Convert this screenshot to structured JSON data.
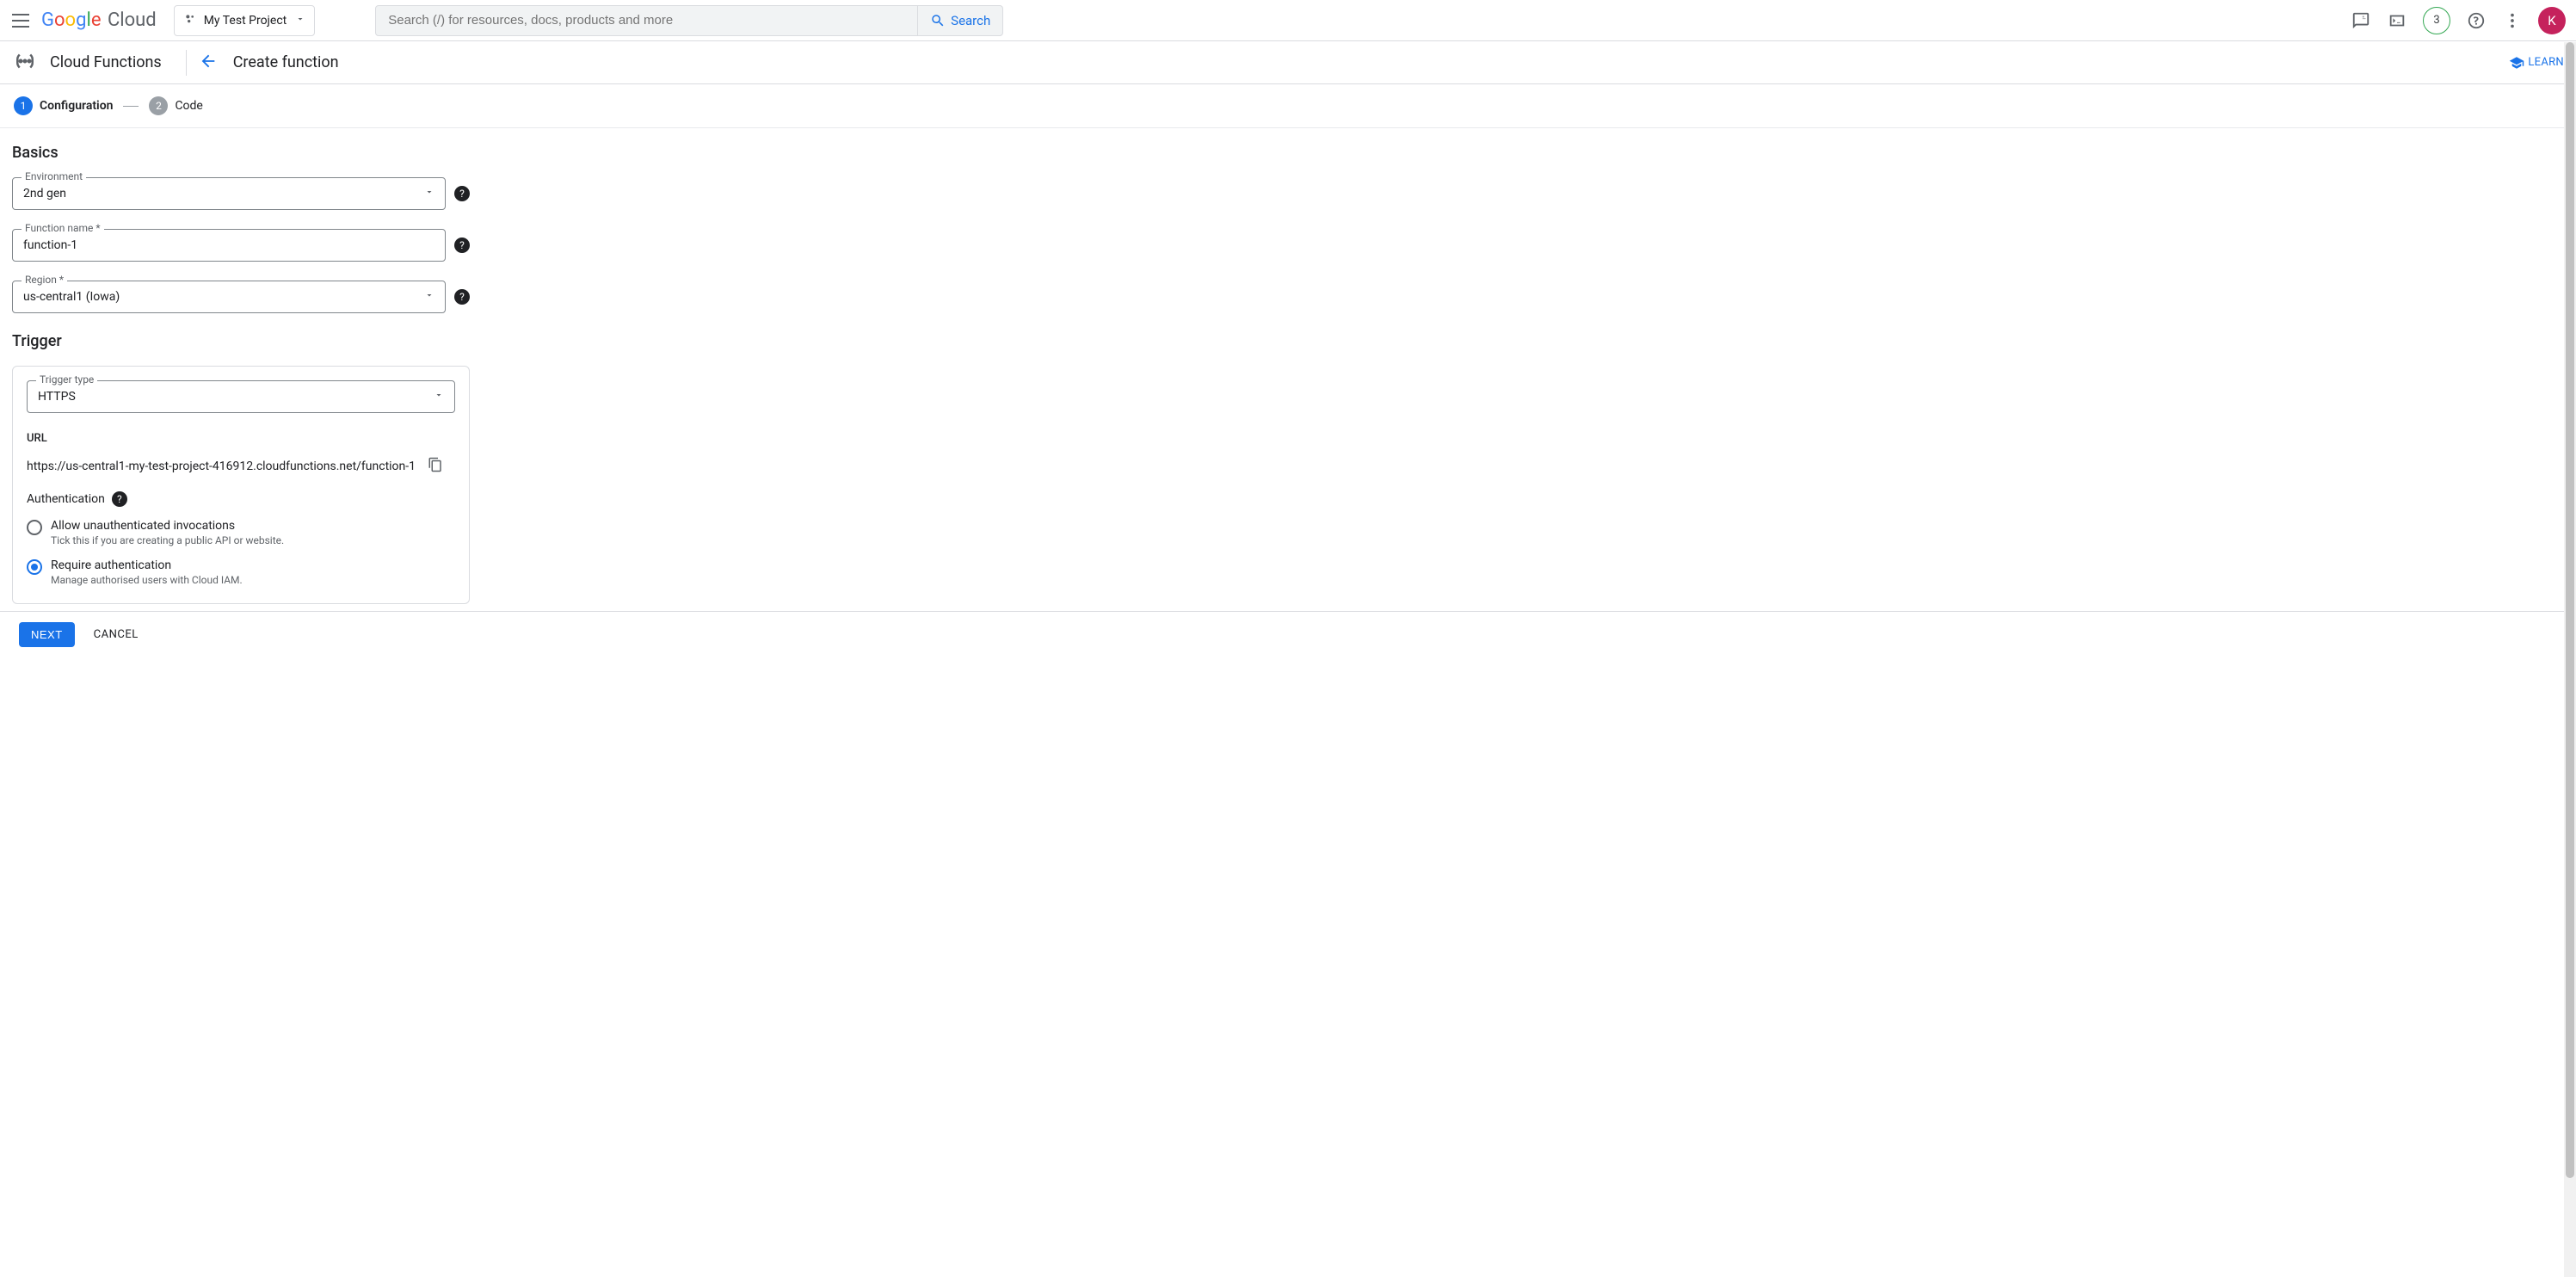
{
  "header": {
    "project_name": "My Test Project",
    "search_placeholder": "Search (/) for resources, docs, products and more",
    "search_button": "Search",
    "badge_count": "3",
    "avatar_letter": "K"
  },
  "subheader": {
    "product": "Cloud Functions",
    "page_title": "Create function",
    "learn": "LEARN"
  },
  "stepper": {
    "step1_num": "1",
    "step1_label": "Configuration",
    "step2_num": "2",
    "step2_label": "Code"
  },
  "basics": {
    "title": "Basics",
    "environment_label": "Environment",
    "environment_value": "2nd gen",
    "function_name_label": "Function name *",
    "function_name_value": "function-1",
    "region_label": "Region *",
    "region_value": "us-central1 (Iowa)"
  },
  "trigger": {
    "title": "Trigger",
    "type_label": "Trigger type",
    "type_value": "HTTPS",
    "url_label": "URL",
    "url_value": "https://us-central1-my-test-project-416912.cloudfunctions.net/function-1",
    "auth_title": "Authentication",
    "auth_option1_label": "Allow unauthenticated invocations",
    "auth_option1_desc": "Tick this if you are creating a public API or website.",
    "auth_option2_label": "Require authentication",
    "auth_option2_desc": "Manage authorised users with Cloud IAM."
  },
  "actions": {
    "next": "NEXT",
    "cancel": "CANCEL"
  }
}
